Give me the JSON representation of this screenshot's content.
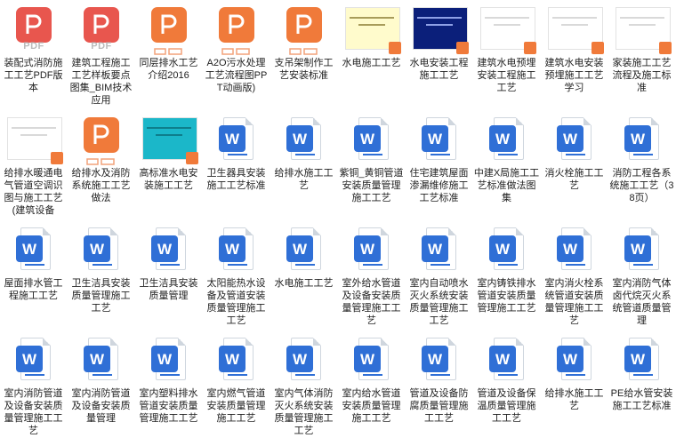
{
  "colors": {
    "pdf_red": "#e8564e",
    "ppt_orange": "#f07a3a",
    "word_blue": "#2f6fd6",
    "yellow_doc": "#fffbcc",
    "navy_doc": "#0b1f7a",
    "teal_doc": "#1bb7c9"
  },
  "pdf_label": "PDF",
  "items": [
    {
      "label": "装配式消防施工工艺PDF版本",
      "icon": "pdf-icon"
    },
    {
      "label": "建筑工程施工工艺样板要点图集_BIM技术应用",
      "icon": "pdf-icon"
    },
    {
      "label": "同层排水工艺介绍2016",
      "icon": "ppt-icon"
    },
    {
      "label": "A2O污水处理工艺流程图PPT动画版)",
      "icon": "ppt-icon"
    },
    {
      "label": "支吊架制作工艺安装标准",
      "icon": "ppt-icon"
    },
    {
      "label": "水电施工工艺",
      "icon": "yellow-document-thumbnail"
    },
    {
      "label": "水电安装工程施工工艺",
      "icon": "navy-document-thumbnail"
    },
    {
      "label": "建筑水电预埋安装工程施工工艺",
      "icon": "white-document-thumbnail"
    },
    {
      "label": "建筑水电安装预埋施工工艺学习",
      "icon": "white-document-thumbnail"
    },
    {
      "label": "家装施工工艺流程及施工标准",
      "icon": "white-document-thumbnail"
    },
    {
      "label": "给排水暖通电气管道空调识图与施工工艺(建筑设备",
      "icon": "white-document-thumbnail"
    },
    {
      "label": "给排水及消防系统施工工艺做法",
      "icon": "ppt-icon"
    },
    {
      "label": "高标准水电安装施工工艺",
      "icon": "teal-document-thumbnail"
    },
    {
      "label": "卫生器具安装施工工艺标准",
      "icon": "word-icon"
    },
    {
      "label": "给排水施工工艺",
      "icon": "word-icon"
    },
    {
      "label": "紫铜_黄铜管道安装质量管理施工工艺",
      "icon": "word-icon"
    },
    {
      "label": "住宅建筑屋面渗漏维修施工工艺标准",
      "icon": "word-icon"
    },
    {
      "label": "中建X局施工工艺标准做法图集",
      "icon": "word-icon"
    },
    {
      "label": "消火栓施工工艺",
      "icon": "word-icon"
    },
    {
      "label": "消防工程各系统施工工艺（38页）",
      "icon": "word-icon"
    },
    {
      "label": "屋面排水管工程施工工艺",
      "icon": "word-icon"
    },
    {
      "label": "卫生洁具安装质量管理施工工艺",
      "icon": "word-icon"
    },
    {
      "label": "卫生洁具安装质量管理",
      "icon": "word-icon"
    },
    {
      "label": "太阳能热水设备及管道安装质量管理施工工艺",
      "icon": "word-icon"
    },
    {
      "label": "水电施工工艺",
      "icon": "word-icon"
    },
    {
      "label": "室外给水管道及设备安装质量管理施工工艺",
      "icon": "word-icon"
    },
    {
      "label": "室内自动喷水灭火系统安装质量管理施工工艺",
      "icon": "word-icon"
    },
    {
      "label": "室内铸铁排水管道安装质量管理施工工艺",
      "icon": "word-icon"
    },
    {
      "label": "室内消火栓系统管道安装质量管理施工工艺",
      "icon": "word-icon"
    },
    {
      "label": "室内消防气体卤代烷灭火系统管道质量管理",
      "icon": "word-icon"
    },
    {
      "label": "室内消防管道及设备安装质量管理施工工艺",
      "icon": "word-icon"
    },
    {
      "label": "室内消防管道及设备安装质量管理",
      "icon": "word-icon"
    },
    {
      "label": "室内塑料排水管道安装质量管理施工工艺",
      "icon": "word-icon"
    },
    {
      "label": "室内燃气管道安装质量管理施工工艺",
      "icon": "word-icon"
    },
    {
      "label": "室内气体消防灭火系统安装质量管理施工工艺",
      "icon": "word-icon"
    },
    {
      "label": "室内给水管道安装质量管理施工工艺",
      "icon": "word-icon"
    },
    {
      "label": "管道及设备防腐质量管理施工工艺",
      "icon": "word-icon"
    },
    {
      "label": "管道及设备保温质量管理施工工艺",
      "icon": "word-icon"
    },
    {
      "label": "给排水施工工艺",
      "icon": "word-icon"
    },
    {
      "label": "PE给水管安装施工工艺标准",
      "icon": "word-icon"
    }
  ]
}
